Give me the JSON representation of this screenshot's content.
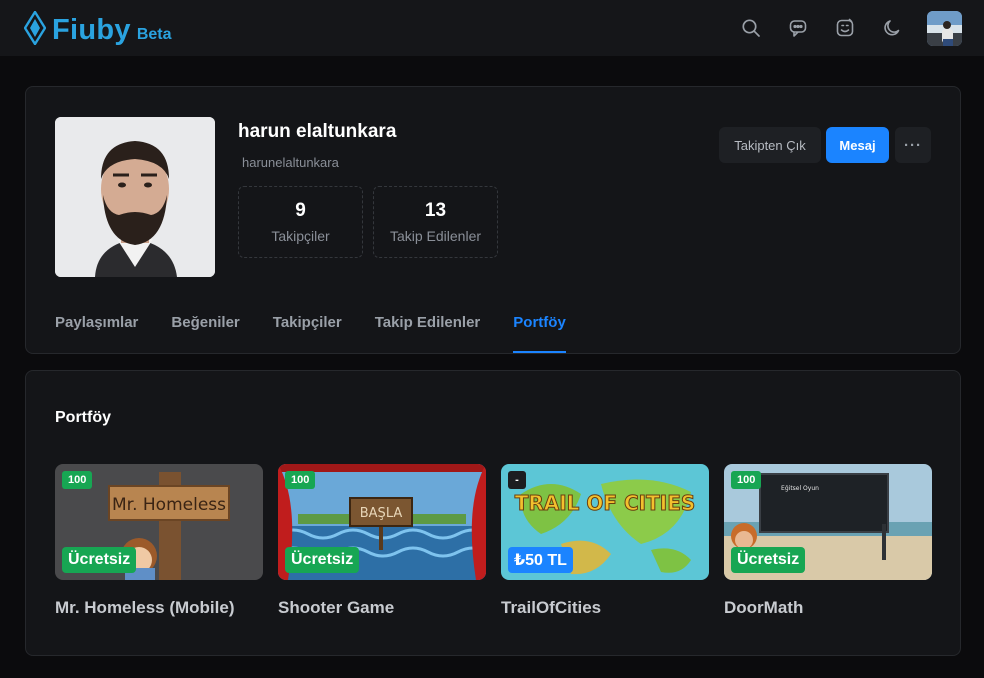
{
  "header": {
    "brand_name": "Fiuby",
    "brand_beta": "Beta",
    "icons": [
      "search-icon",
      "chat-icon",
      "emoji-icon",
      "moon-icon"
    ],
    "accent": "#2aa3e0"
  },
  "profile": {
    "name": "harun elaltunkara",
    "handle": "harunelaltunkara",
    "stats": [
      {
        "value": "9",
        "label": "Takipçiler"
      },
      {
        "value": "13",
        "label": "Takip Edilenler"
      }
    ],
    "unfollow_label": "Takipten Çık",
    "message_label": "Mesaj",
    "more_label": "···"
  },
  "tabs": [
    {
      "label": "Paylaşımlar",
      "active": false
    },
    {
      "label": "Beğeniler",
      "active": false
    },
    {
      "label": "Takipçiler",
      "active": false
    },
    {
      "label": "Takip Edilenler",
      "active": false
    },
    {
      "label": "Portföy",
      "active": true
    }
  ],
  "portfolio": {
    "title": "Portföy",
    "games": [
      {
        "name": "Mr. Homeless (Mobile)",
        "top_badge": "100",
        "price": "Ücretsiz",
        "thumb_text": "Mr. Homeless"
      },
      {
        "name": "Shooter Game",
        "top_badge": "100",
        "price": "Ücretsiz",
        "thumb_text": "BAŞLA"
      },
      {
        "name": "TrailOfCities",
        "top_badge": "-",
        "price": "₺50 TL",
        "thumb_text": "TRAIL OF CITIES"
      },
      {
        "name": "DoorMath",
        "top_badge": "100",
        "price": "Ücretsiz",
        "thumb_text": "Eğitsel Oyun"
      }
    ]
  },
  "colors": {
    "primary": "#1b84ff",
    "free_badge": "#17a653",
    "card": "#141518"
  }
}
